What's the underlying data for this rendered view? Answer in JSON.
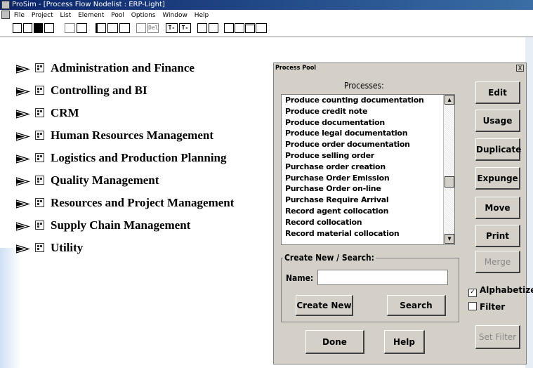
{
  "app": {
    "title": "ProSim - [Process Flow Nodelist : ERP-Light]"
  },
  "menu": [
    "File",
    "Project",
    "List",
    "Element",
    "Pool",
    "Options",
    "Window",
    "Help"
  ],
  "toolbar": {
    "tool_texts": [
      "T-",
      "T-",
      "Del"
    ]
  },
  "tree": {
    "items": [
      "Administration and Finance",
      "Controlling and BI",
      "CRM",
      "Human Resources Management",
      "Logistics and Production Planning",
      "Quality Management",
      "Resources and Project Management",
      "Supply Chain Management",
      "Utility"
    ]
  },
  "dialog": {
    "title": "Process Pool",
    "close_label": "X",
    "processes_label": "Processes:",
    "processes": [
      "Produce counting documentation",
      "Produce credit  note",
      "Produce documentation",
      "Produce legal documentation",
      "Produce order documentation",
      "Produce selling order",
      "Purchase order creation",
      "Purchase Order Emission",
      "Purchase Order on-line",
      "Purchase Require Arrival",
      "Record agent collocation",
      "Record collocation",
      "Record material collocation"
    ],
    "buttons": {
      "edit": "Edit",
      "usage": "Usage",
      "duplicate": "Duplicate",
      "expunge": "Expunge",
      "move": "Move",
      "print": "Print",
      "merge": "Merge",
      "set_filter": "Set Filter",
      "create_new": "Create New",
      "search": "Search",
      "done": "Done",
      "help": "Help"
    },
    "create_group_label": "Create New / Search:",
    "name_label": "Name:",
    "name_value": "",
    "alphabetize_label": "Alphabetize",
    "alphabetize_checked": true,
    "filter_label": "Filter",
    "filter_checked": false
  }
}
